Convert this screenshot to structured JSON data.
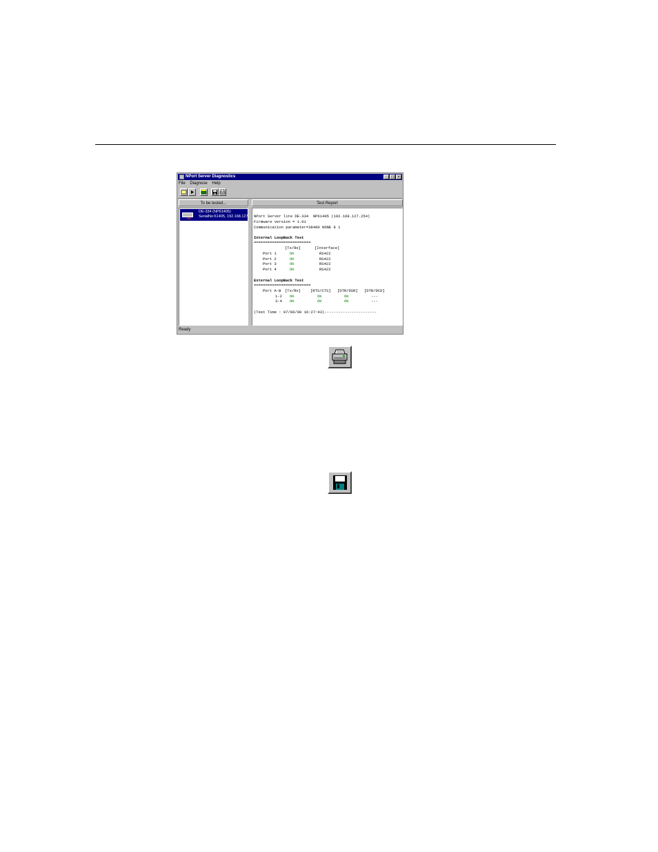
{
  "window": {
    "title": "NPort Server Diagnostics",
    "controls": {
      "minimize": "_",
      "maximize": "□",
      "close": "×"
    },
    "menu": [
      "File",
      "Diagnose",
      "Help"
    ],
    "status": "Ready"
  },
  "toolbar": {
    "icons": [
      "open-icon",
      "play-icon",
      "test-icon",
      "save-icon",
      "print-icon"
    ]
  },
  "left_pane": {
    "header": "To be tested...",
    "device": {
      "line1": "DE-334 (NP61405)",
      "line2": "SerialNo:61405, 192.168.127.",
      "badge": "OK"
    }
  },
  "right_pane": {
    "header": "Test Report",
    "report": {
      "l1": "NPort Server lite DE-334  NP61405 (192.168.127.254)",
      "l2": "Firmware version = 1.01",
      "l3": "Communication parameter=38400 NONE 8 1",
      "internal_title": "Internal LoopBack Test",
      "rule1": "=========================",
      "internal_cols": {
        "a": "[Tx/Rx]",
        "b": "[Interface]"
      },
      "internal_rows": [
        {
          "port": "Port 1",
          "txrx": "OK",
          "iface": "RS422"
        },
        {
          "port": "Port 2",
          "txrx": "OK",
          "iface": "RS422"
        },
        {
          "port": "Port 3",
          "txrx": "OK",
          "iface": "RS422"
        },
        {
          "port": "Port 4",
          "txrx": "OK",
          "iface": "RS422"
        }
      ],
      "external_title": "External LoopBack Test",
      "rule2": "=========================",
      "external_cols": {
        "port": "Port A-B",
        "a": "[Tx/Rx]",
        "b": "[RTS/CTS]",
        "c": "[DTR/DSR]",
        "d": "[DTR/DCD]"
      },
      "external_rows": [
        {
          "port": "1-2",
          "txrx": "OK",
          "rtscts": "OK",
          "dtrdsr": "OK",
          "dtrdcd": "---"
        },
        {
          "port": "3-4",
          "txrx": "OK",
          "rtscts": "OK",
          "dtrdsr": "OK",
          "dtrdcd": "---"
        }
      ],
      "test_time": "(Test Time : 07/06/00 16:27:43)-----------------------"
    }
  },
  "standalone_icons": [
    "print-icon",
    "save-icon"
  ]
}
